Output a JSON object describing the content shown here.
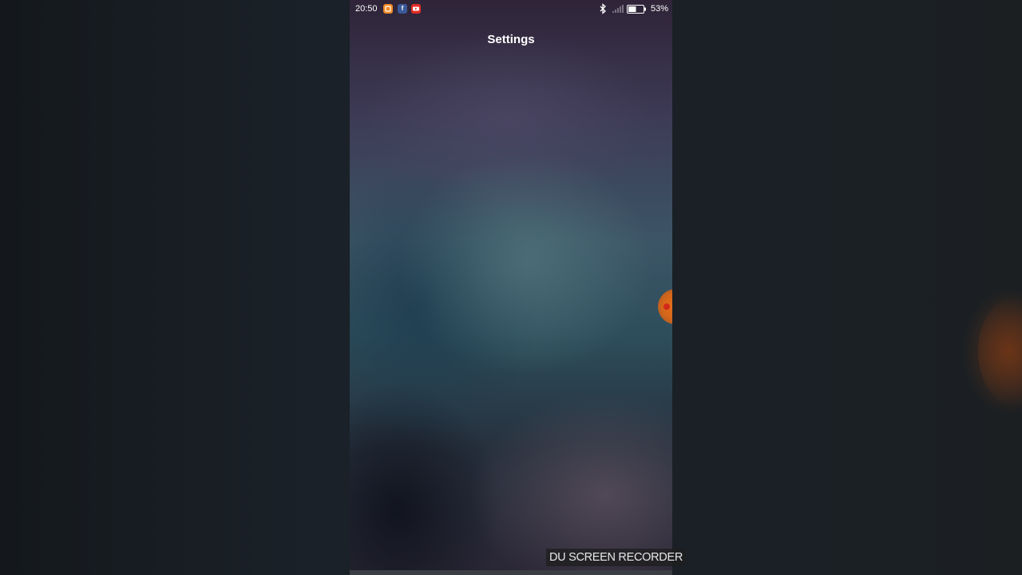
{
  "status_bar": {
    "time": "20:50",
    "battery_percent": "53%",
    "battery_level": 0.53,
    "notification_icons": [
      "photo-app-icon",
      "facebook-icon",
      "youtube-icon"
    ],
    "status_icons": [
      "bluetooth-icon",
      "signal-icon",
      "battery-icon"
    ]
  },
  "screen": {
    "title": "Settings"
  },
  "overlay": {
    "watermark": "DU SCREEN RECORDER",
    "floating_button": "du-recorder-bubble"
  },
  "colors": {
    "facebook": "#3b5998",
    "youtube": "#e52d27",
    "photo_app": "#f08a24",
    "recorder_bubble": "#e7701a"
  }
}
